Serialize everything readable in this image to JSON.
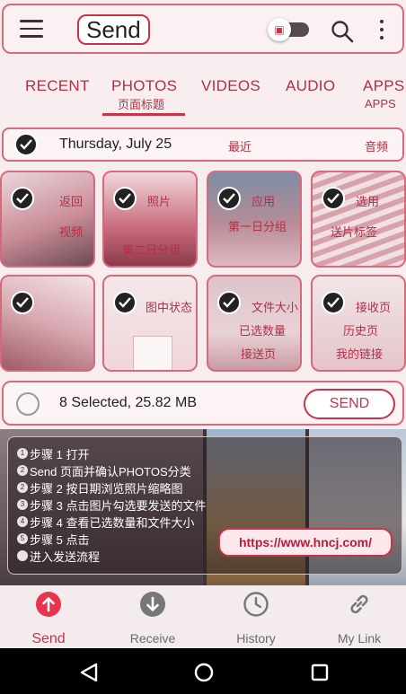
{
  "appbar": {
    "title": "Send",
    "icons": [
      "menu-icon",
      "cast-toggle",
      "search-icon",
      "more-vert-icon"
    ]
  },
  "tabs": [
    {
      "label": "RECENT",
      "sub": "",
      "active": false
    },
    {
      "label": "PHOTOS",
      "sub": "页面标题",
      "active": true
    },
    {
      "label": "VIDEOS",
      "sub": "",
      "active": false
    },
    {
      "label": "AUDIO",
      "sub": "",
      "active": false
    },
    {
      "label": "APPS",
      "sub": "APPS",
      "active": false
    }
  ],
  "date_group": {
    "date": "Thursday, July 25",
    "label_recent": "最近",
    "label_audio": "音频"
  },
  "tiles": [
    {
      "labels": [
        "返回",
        "视频"
      ]
    },
    {
      "labels": [
        "照片",
        "第二日分组"
      ]
    },
    {
      "labels": [
        "应用",
        "第一日分组"
      ]
    },
    {
      "labels": [
        "选用",
        "送片标签"
      ]
    },
    {
      "labels": []
    },
    {
      "labels": [
        "图中状态"
      ]
    },
    {
      "labels": [
        "文件大小",
        "已选数量",
        "接送页"
      ]
    },
    {
      "labels": [
        "接收页",
        "历史页",
        "我的链接"
      ]
    }
  ],
  "selection": {
    "text": "8 Selected, 25.82 MB",
    "send_label": "SEND"
  },
  "steps": [
    {
      "num": "1",
      "text": "步骤 1 打开"
    },
    {
      "num": "2",
      "text": "Send 页面并确认PHOTOS分类"
    },
    {
      "num": "2",
      "text": "步骤 2 按日期浏览照片缩略图"
    },
    {
      "num": "3",
      "text": "步骤 3 点击图片勾选要发送的文件"
    },
    {
      "num": "4",
      "text": "步骤 4 查看已选数量和文件大小"
    },
    {
      "num": "5",
      "text": "步骤 5 点击"
    },
    {
      "num": "",
      "text": "进入发送流程"
    }
  ],
  "url": "https://www.hncj.com/",
  "bottom_nav": [
    {
      "label": "Send",
      "icon": "upload-circle-icon",
      "active": true
    },
    {
      "label": "Receive",
      "icon": "download-circle-icon",
      "active": false
    },
    {
      "label": "History",
      "icon": "clock-icon",
      "active": false
    },
    {
      "label": "My Link",
      "icon": "link-icon",
      "active": false
    }
  ],
  "colors": {
    "accent": "#c8334a",
    "frame": "#d76a7a"
  }
}
